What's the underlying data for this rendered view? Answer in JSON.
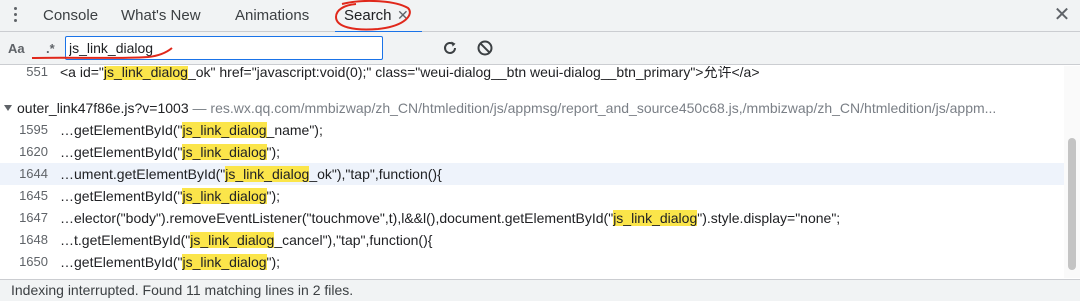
{
  "tabs": [
    {
      "label": "Console"
    },
    {
      "label": "What's New"
    },
    {
      "label": "Animations"
    },
    {
      "label": "Search",
      "active": true
    }
  ],
  "icons": {
    "menu": "kebab-menu-icon",
    "tab_close": "✕",
    "panel_close": "✕",
    "refresh": "refresh-icon",
    "clear": "clear-icon"
  },
  "search": {
    "case_label": "Aa",
    "regex_label": ".*",
    "query": "js_link_dialog"
  },
  "results": {
    "top_line": {
      "line": "551",
      "parts": [
        "<a id=\"",
        "js_link_dialog",
        "_ok\" href=\"javascript:void(0);\" class=\"weui-dialog__btn weui-dialog__btn_primary\">允许</a>"
      ]
    },
    "file": {
      "name": "outer_link47f86e.js?v=1003",
      "path": " — res.wx.qq.com/mmbizwap/zh_CN/htmledition/js/appmsg/report_and_source450c68.js,/mmbizwap/zh_CN/htmledition/js/appm..."
    },
    "matches": [
      {
        "line": "1595",
        "parts": [
          "…getElementById(\"",
          "js_link_dialog",
          "_name\");"
        ]
      },
      {
        "line": "1620",
        "parts": [
          "…getElementById(\"",
          "js_link_dialog",
          "\");"
        ]
      },
      {
        "line": "1644",
        "parts": [
          "…ument.getElementById(\"",
          "js_link_dialog",
          "_ok\"),\"tap\",function(){"
        ]
      },
      {
        "line": "1645",
        "parts": [
          "…getElementById(\"",
          "js_link_dialog",
          "\");"
        ]
      },
      {
        "line": "1647",
        "parts": [
          "…elector(\"body\").removeEventListener(\"touchmove\",t),l&&l(),document.getElementById(\"",
          "js_link_dialog",
          "\").style.display=\"none\";"
        ]
      },
      {
        "line": "1648",
        "parts": [
          "…t.getElementById(\"",
          "js_link_dialog",
          "_cancel\"),\"tap\",function(){"
        ]
      },
      {
        "line": "1650",
        "parts": [
          "…getElementById(\"",
          "js_link_dialog",
          "\");"
        ]
      }
    ]
  },
  "status": {
    "text": "Indexing interrupted.  Found 11 matching lines in 2 files."
  },
  "colors": {
    "accent": "#1a73e8",
    "highlight": "#fbe54a",
    "annotation": "#e0281b"
  }
}
